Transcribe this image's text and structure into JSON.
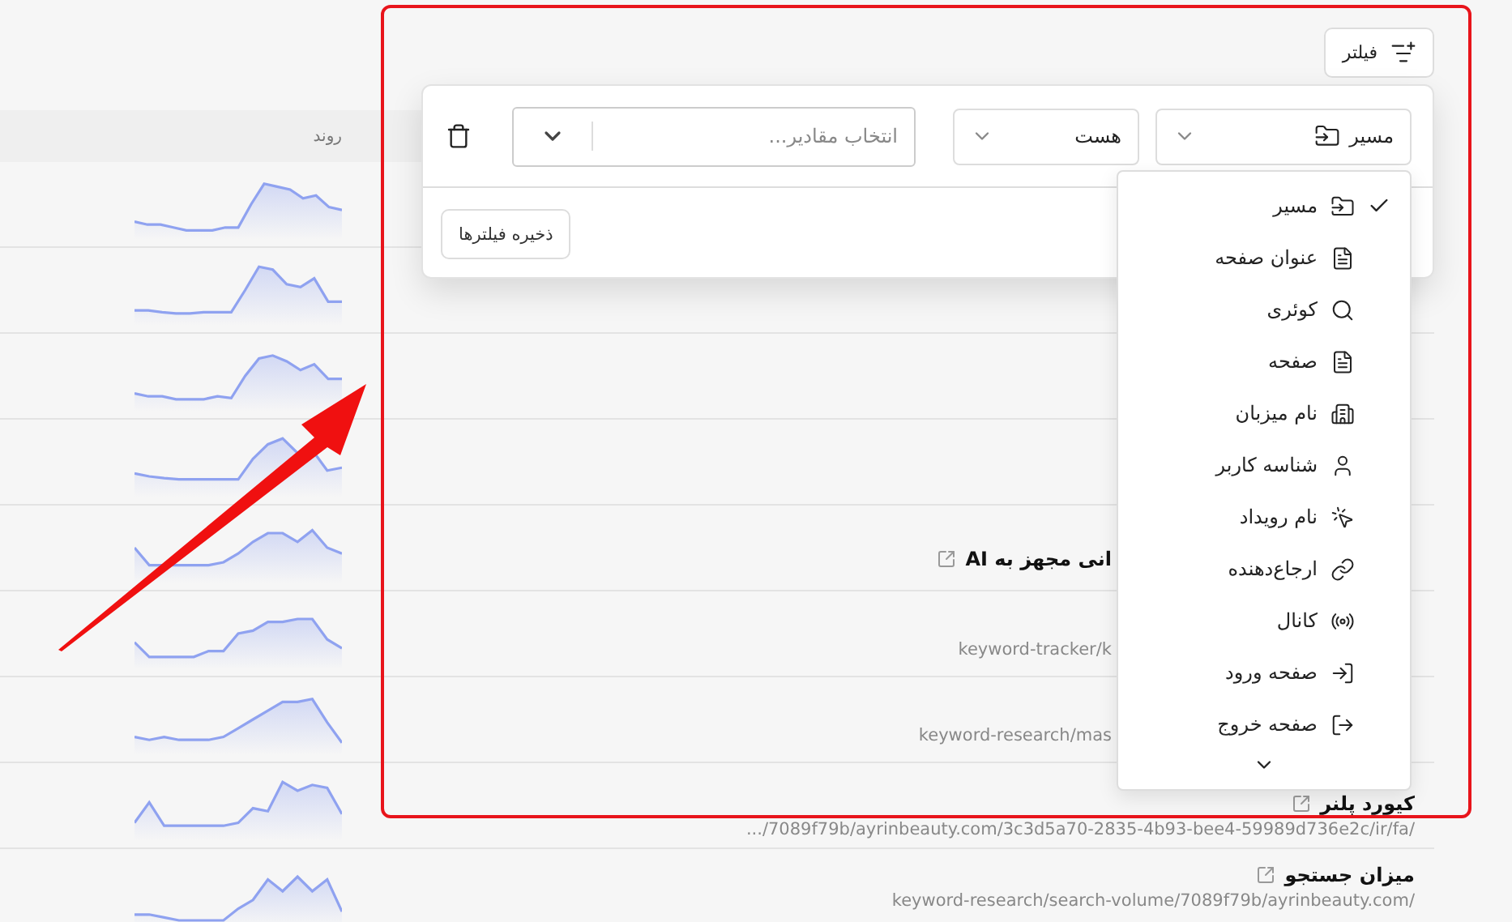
{
  "toolbar": {
    "filter_button": "فیلتر"
  },
  "table": {
    "columns": [
      {
        "label": "روند"
      }
    ],
    "rows": [
      {},
      {},
      {},
      {},
      {
        "title_fragment": "انی مجهز به AI"
      },
      {
        "url": "keyword-tracker/k"
      },
      {
        "url": "keyword-research/mas"
      },
      {
        "title": "کیورد پلنر",
        "url": ".../7089f79b/ayrinbeauty.com/3c3d5a70-2835-4b93-bee4-59989d736e2c/ir/fa/"
      },
      {
        "title": "میزان جستجو",
        "url": "keyword-research/search-volume/7089f79b/ayrinbeauty.com/"
      }
    ]
  },
  "filter_panel": {
    "field": "مسیر",
    "operator": "هست",
    "values_placeholder": "انتخاب مقادیر...",
    "save_button": "ذخیره فیلترها"
  },
  "field_menu": {
    "items": [
      {
        "label": "مسیر",
        "kind": "folder",
        "selected": true
      },
      {
        "label": "عنوان صفحه",
        "kind": "document",
        "selected": false
      },
      {
        "label": "کوئری",
        "kind": "search",
        "selected": false
      },
      {
        "label": "صفحه",
        "kind": "document",
        "selected": false
      },
      {
        "label": "نام میزبان",
        "kind": "building",
        "selected": false
      },
      {
        "label": "شناسه کاربر",
        "kind": "user",
        "selected": false
      },
      {
        "label": "نام رویداد",
        "kind": "pointer",
        "selected": false
      },
      {
        "label": "ارجاع‌دهنده",
        "kind": "link",
        "selected": false
      },
      {
        "label": "کانال",
        "kind": "radio",
        "selected": false
      },
      {
        "label": "صفحه ورود",
        "kind": "login",
        "selected": false
      },
      {
        "label": "صفحه خروج",
        "kind": "logout",
        "selected": false
      }
    ]
  }
}
